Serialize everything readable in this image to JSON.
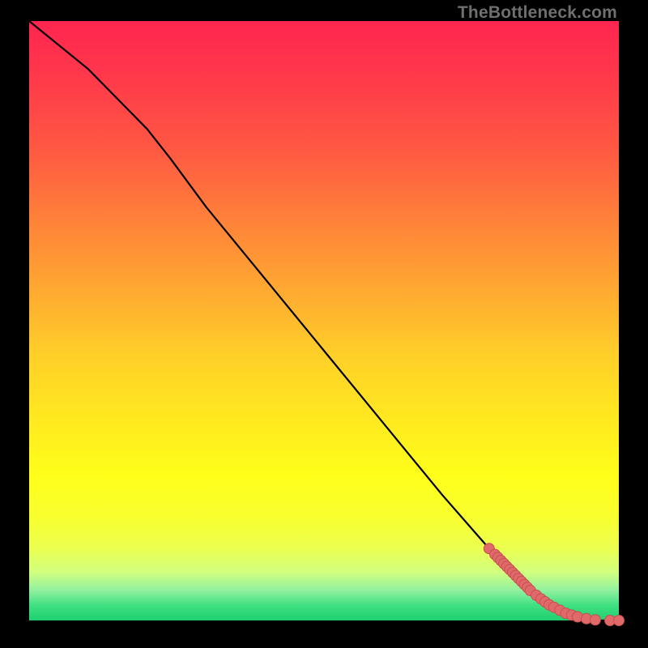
{
  "watermark": "TheBottleneck.com",
  "colors": {
    "line": "#000000",
    "dot_fill": "#e06a6a",
    "dot_stroke": "#c84f4f"
  },
  "chart_data": {
    "type": "line",
    "title": "",
    "xlabel": "",
    "ylabel": "",
    "xlim": [
      0,
      100
    ],
    "ylim": [
      0,
      100
    ],
    "series": [
      {
        "name": "curve",
        "x": [
          0,
          10,
          20,
          24,
          30,
          40,
          50,
          60,
          70,
          78,
          84,
          88,
          92,
          96,
          100
        ],
        "y": [
          100,
          92,
          82,
          77,
          69,
          57,
          45,
          33,
          21,
          12,
          6,
          3,
          1,
          0,
          0
        ]
      }
    ],
    "points": {
      "name": "dots",
      "x": [
        78,
        79,
        79.5,
        80,
        80.5,
        81,
        81.5,
        82,
        82.5,
        83,
        83.5,
        84,
        84.5,
        85,
        86,
        86.8,
        87.5,
        88.2,
        89,
        90,
        91,
        92,
        93,
        94.5,
        96,
        98.5,
        100
      ],
      "y": [
        12,
        11,
        10.5,
        10,
        9.5,
        9,
        8.5,
        8,
        7.5,
        7,
        6.5,
        6,
        5.5,
        5,
        4.2,
        3.6,
        3.1,
        2.6,
        2.2,
        1.7,
        1.2,
        0.9,
        0.6,
        0.3,
        0.1,
        0,
        0
      ]
    }
  }
}
